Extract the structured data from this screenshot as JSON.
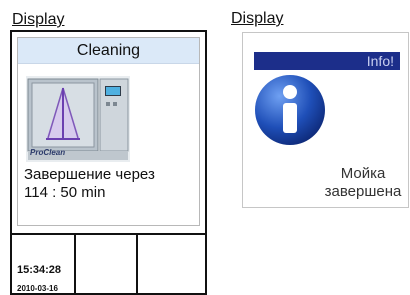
{
  "left_panel": {
    "label": "Display",
    "title": "Cleaning",
    "machine_brand": "ProClean",
    "status_line1": "Завершение через",
    "status_line2": "114 : 50 min",
    "time": "15:34:28",
    "date": "2010-03-16"
  },
  "right_panel": {
    "label": "Display",
    "header": "Info!",
    "message_line1": "Мойка",
    "message_line2": "завершена"
  },
  "colors": {
    "title_bg": "#dbe9f8",
    "info_bar_bg": "#1c2e8a",
    "info_icon_blue": "#1f4fb8"
  }
}
